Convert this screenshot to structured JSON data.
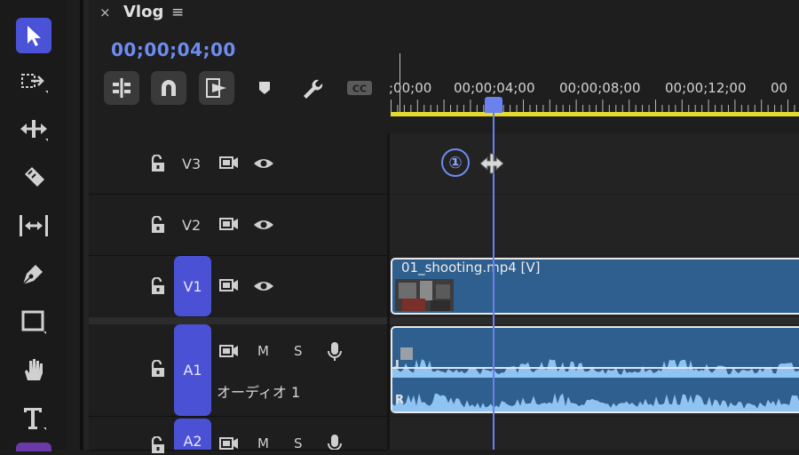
{
  "tab": {
    "close_glyph": "×",
    "title": "Vlog",
    "menu_glyph": "≡"
  },
  "timecode": "00;00;04;00",
  "header_buttons": [
    {
      "icon": "insert-edit-icon",
      "active": true
    },
    {
      "icon": "snap-magnet-icon",
      "active": true
    },
    {
      "icon": "linked-selection-icon",
      "active": true
    },
    {
      "icon": "marker-icon",
      "active": false
    },
    {
      "icon": "wrench-settings-icon",
      "active": false
    },
    {
      "icon": "captions-cc-icon",
      "active": false
    }
  ],
  "cc_label": "CC",
  "ruler": {
    "labels": [
      ";00;00",
      "00;00;04;00",
      "00;00;08;00",
      "00;00;12;00",
      "00"
    ]
  },
  "tools": [
    "selection-tool-icon",
    "track-select-forward-icon",
    "ripple-edit-icon",
    "razor-tool-icon",
    "slip-tool-icon",
    "pen-tool-icon",
    "rectangle-tool-icon",
    "hand-tool-icon",
    "type-tool-icon"
  ],
  "tracks": {
    "v3": {
      "label": "V3"
    },
    "v2": {
      "label": "V2"
    },
    "v1": {
      "label": "V1",
      "target": "V1"
    },
    "a1": {
      "target": "A1",
      "m": "M",
      "s": "S",
      "name": "オーディオ 1"
    },
    "a2": {
      "target": "A2",
      "m": "M",
      "s": "S"
    }
  },
  "clips": {
    "video": {
      "name": "01_shooting.mp4 [V]"
    },
    "audio": {
      "left": "L",
      "right": "R"
    }
  },
  "step_marker": "①",
  "colors": {
    "accent": "#4b51d4",
    "timecode": "#6e8cf0",
    "clip": "#2f5f8e",
    "work_area": "#e5dc2f"
  }
}
